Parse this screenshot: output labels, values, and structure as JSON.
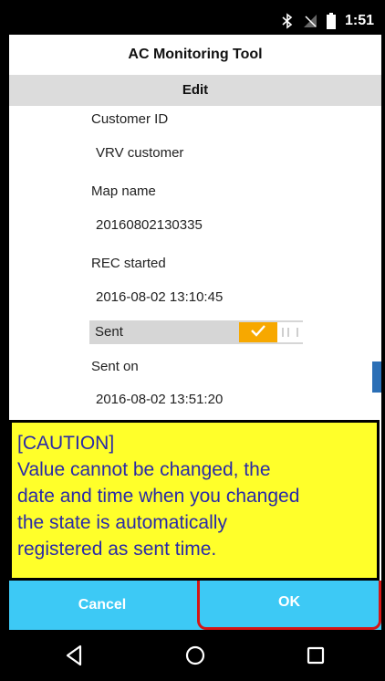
{
  "status_bar": {
    "icons": [
      "bluetooth-icon",
      "no-signal-icon",
      "battery-icon"
    ],
    "time": "1:51"
  },
  "app": {
    "title": "AC Monitoring Tool"
  },
  "header": {
    "title": "Edit"
  },
  "fields": {
    "customer_id": {
      "label": "Customer ID",
      "value": "VRV customer"
    },
    "map_name": {
      "label": "Map name",
      "value": "20160802130335"
    },
    "rec_started": {
      "label": "REC started",
      "value": "2016-08-02 13:10:45"
    },
    "sent": {
      "label": "Sent",
      "checked": true
    },
    "sent_on": {
      "label": "Sent on",
      "value": "2016-08-02 13:51:20"
    }
  },
  "caution": {
    "lines": [
      "[CAUTION]",
      "Value cannot be changed, the",
      "date and time when you changed",
      "the state is automatically",
      "registered as sent time."
    ]
  },
  "buttons": {
    "cancel": "Cancel",
    "ok": "OK"
  },
  "nav": {
    "icons": [
      "back-icon",
      "home-icon",
      "recents-icon"
    ]
  },
  "colors": {
    "accent": "#3dc9f5",
    "toggle_on": "#f7a800",
    "caution_bg": "#ffff2a",
    "caution_text": "#2a2aa8",
    "highlight": "#d41515"
  }
}
